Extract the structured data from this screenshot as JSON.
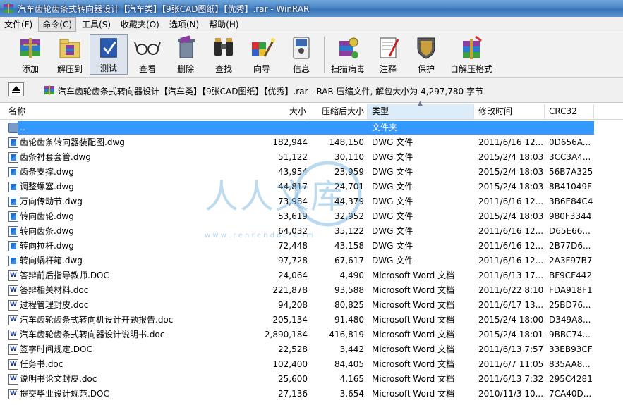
{
  "window": {
    "title": "汽车齿轮齿条式转向器设计【汽车类】【9张CAD图纸】【优秀】.rar - WinRAR"
  },
  "menu": [
    "文件(F)",
    "命令(C)",
    "工具(S)",
    "收藏夹(O)",
    "选项(N)",
    "帮助(H)"
  ],
  "toolbar": {
    "add": "添加",
    "extract": "解压到",
    "test": "测试",
    "view": "查看",
    "delete": "删除",
    "find": "查找",
    "wizard": "向导",
    "info": "信息",
    "scan": "扫描病毒",
    "comment": "注释",
    "protect": "保护",
    "sfx": "自解压格式"
  },
  "address": {
    "text": "汽车齿轮齿条式转向器设计【汽车类】【9张CAD图纸】【优秀】.rar - RAR 压缩文件, 解包大小为 4,297,780 字节"
  },
  "columns": {
    "name": "名称",
    "size": "大小",
    "packed": "压缩后大小",
    "type": "类型",
    "mtime": "修改时间",
    "crc": "CRC32"
  },
  "files": [
    {
      "name": "..",
      "size": "",
      "packed": "",
      "type": "文件夹",
      "mtime": "",
      "crc": "",
      "icon": "folder"
    },
    {
      "name": "齿轮齿条转向器装配图.dwg",
      "size": "182,944",
      "packed": "148,150",
      "type": "DWG 文件",
      "mtime": "2011/6/16 12...",
      "crc": "0D656A...",
      "icon": "dwg"
    },
    {
      "name": "齿条衬套套管.dwg",
      "size": "51,122",
      "packed": "30,110",
      "type": "DWG 文件",
      "mtime": "2015/2/4 18:03",
      "crc": "3CC3A4...",
      "icon": "dwg"
    },
    {
      "name": "齿条支撑.dwg",
      "size": "43,954",
      "packed": "23,959",
      "type": "DWG 文件",
      "mtime": "2015/2/4 18:03",
      "crc": "56B7A325",
      "icon": "dwg"
    },
    {
      "name": "调整螺塞.dwg",
      "size": "44,817",
      "packed": "24,701",
      "type": "DWG 文件",
      "mtime": "2015/2/4 18:03",
      "crc": "8B41049F",
      "icon": "dwg"
    },
    {
      "name": "万向传动节.dwg",
      "size": "73,984",
      "packed": "44,379",
      "type": "DWG 文件",
      "mtime": "2011/6/16 12...",
      "crc": "3B6E84C4",
      "icon": "dwg"
    },
    {
      "name": "转向齿轮.dwg",
      "size": "53,619",
      "packed": "32,952",
      "type": "DWG 文件",
      "mtime": "2015/2/4 18:03",
      "crc": "980F3344",
      "icon": "dwg"
    },
    {
      "name": "转向齿条.dwg",
      "size": "64,032",
      "packed": "35,122",
      "type": "DWG 文件",
      "mtime": "2011/6/16 12...",
      "crc": "D65E66...",
      "icon": "dwg"
    },
    {
      "name": "转向拉杆.dwg",
      "size": "72,448",
      "packed": "43,158",
      "type": "DWG 文件",
      "mtime": "2011/6/16 12...",
      "crc": "2B77D6...",
      "icon": "dwg"
    },
    {
      "name": "转向蜗杆箱.dwg",
      "size": "97,728",
      "packed": "67,617",
      "type": "DWG 文件",
      "mtime": "2011/6/16 12...",
      "crc": "2A3F97B7",
      "icon": "dwg"
    },
    {
      "name": "答辩前后指导教师.DOC",
      "size": "24,064",
      "packed": "4,490",
      "type": "Microsoft Word 文档",
      "mtime": "2011/6/13 17...",
      "crc": "BF9CF442",
      "icon": "doc"
    },
    {
      "name": "答辩相关材料.doc",
      "size": "221,878",
      "packed": "93,588",
      "type": "Microsoft Word 文档",
      "mtime": "2011/6/22 8:10",
      "crc": "FDA918F1",
      "icon": "doc"
    },
    {
      "name": "过程管理封皮.doc",
      "size": "94,208",
      "packed": "80,825",
      "type": "Microsoft Word 文档",
      "mtime": "2011/6/17 13...",
      "crc": "25BD76...",
      "icon": "doc"
    },
    {
      "name": "汽车齿轮齿条式转向机设计开题报告.doc",
      "size": "205,134",
      "packed": "91,480",
      "type": "Microsoft Word 文档",
      "mtime": "2015/2/4 18:00",
      "crc": "D349A8...",
      "icon": "doc"
    },
    {
      "name": "汽车齿轮齿条式转向器设计说明书.doc",
      "size": "2,890,184",
      "packed": "416,819",
      "type": "Microsoft Word 文档",
      "mtime": "2015/2/4 18:01",
      "crc": "9BBC74...",
      "icon": "doc"
    },
    {
      "name": "签字时间规定.DOC",
      "size": "22,528",
      "packed": "3,442",
      "type": "Microsoft Word 文档",
      "mtime": "2011/6/13 7:57",
      "crc": "33EB93CF",
      "icon": "doc"
    },
    {
      "name": "任务书.doc",
      "size": "102,400",
      "packed": "84,405",
      "type": "Microsoft Word 文档",
      "mtime": "2011/6/7 11:05",
      "crc": "835AA8...",
      "icon": "doc"
    },
    {
      "name": "说明书论文封皮.doc",
      "size": "25,600",
      "packed": "4,165",
      "type": "Microsoft Word 文档",
      "mtime": "2011/6/13 7:32",
      "crc": "295C4281",
      "icon": "doc"
    },
    {
      "name": "提交毕业设计规范.DOC",
      "size": "27,136",
      "packed": "3,654",
      "type": "Microsoft Word 文档",
      "mtime": "2010/11/3 10...",
      "crc": "7CA40D...",
      "icon": "doc"
    }
  ],
  "watermark": {
    "chars": "人人文库",
    "url": "w w w . r e n r e n d o c . c o m"
  }
}
